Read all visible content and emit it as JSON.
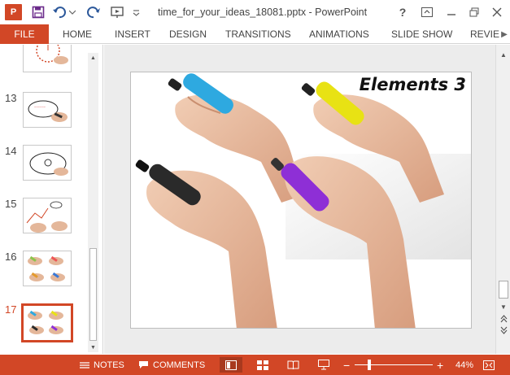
{
  "app": {
    "logo_letter": "P",
    "title": "time_for_your_ideas_18081.pptx - PowerPoint",
    "help": "?",
    "accent": "#d24726"
  },
  "ribbon": {
    "file": "FILE",
    "tabs": [
      "HOME",
      "INSERT",
      "DESIGN",
      "TRANSITIONS",
      "ANIMATIONS",
      "SLIDE SHOW",
      "REVIEW"
    ]
  },
  "thumbnails": [
    {
      "num": "13"
    },
    {
      "num": "14"
    },
    {
      "num": "15"
    },
    {
      "num": "16"
    },
    {
      "num": "17"
    }
  ],
  "slide": {
    "title": "Elements 3",
    "markers": [
      "cyan-marker",
      "yellow-marker",
      "black-marker",
      "purple-marker"
    ],
    "colors": {
      "cyan": "#2ea9e0",
      "yellow": "#e8e214",
      "black": "#2a2a2a",
      "purple": "#8e2fd6"
    }
  },
  "status": {
    "notes": "NOTES",
    "comments": "COMMENTS",
    "zoom": "44%"
  }
}
